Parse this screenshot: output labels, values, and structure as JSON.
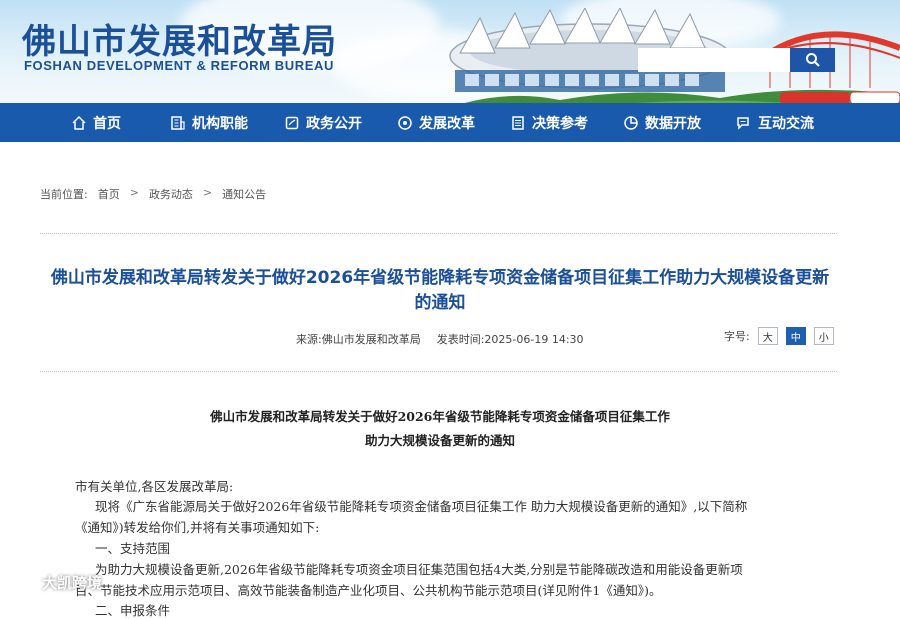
{
  "header": {
    "title": "佛山市发展和改革局",
    "subtitle": "FOSHAN DEVELOPMENT & REFORM BUREAU",
    "search_placeholder": ""
  },
  "nav": [
    {
      "label": "首页",
      "icon": "home-icon"
    },
    {
      "label": "机构职能",
      "icon": "building-icon"
    },
    {
      "label": "政务公开",
      "icon": "document-icon"
    },
    {
      "label": "发展改革",
      "icon": "compass-icon"
    },
    {
      "label": "决策参考",
      "icon": "list-icon"
    },
    {
      "label": "数据开放",
      "icon": "pie-chart-icon"
    },
    {
      "label": "互动交流",
      "icon": "chat-icon"
    }
  ],
  "breadcrumb": {
    "label": "当前位置:",
    "items": [
      "首页",
      "政务动态",
      "通知公告"
    ],
    "separator": ">"
  },
  "article": {
    "title_line1": "佛山市发展和改革局转发关于做好2026年省级节能降耗专项资金储备项目征集工作助力大规模设备更新",
    "title_line2": "的通知",
    "source": "来源:佛山市发展和改革局",
    "publish_time": "发表时间:2025-06-19 14:30",
    "font_size_label": "字号:",
    "font_sizes": [
      "大",
      "中",
      "小"
    ],
    "font_size_active": "中"
  },
  "doc": {
    "title_line1": "佛山市发展和改革局转发关于做好2026年省级节能降耗专项资金储备项目征集工作",
    "title_line2": "助力大规模设备更新的通知",
    "salutation": "市有关单位,各区发展改革局:",
    "para1_line1": "现将《广东省能源局关于做好2026年省级节能降耗专项资金储备项目征集工作 助力大规模设备更新的通知》,以下简称",
    "para1_line2": "《通知》)转发给你们,并将有关事项通知如下:",
    "section1": "一、支持范围",
    "para2_line1": "为助力大规模设备更新,2026年省级节能降耗专项资金项目征集范围包括4大类,分别是节能降碳改造和用能设备更新项",
    "para2_line2": "目、节能技术应用示范项目、高效节能装备制造产业化项目、公共机构节能示范项目(详见附件1《通知》)。",
    "para3_partial": "二、申报条件"
  },
  "watermark": {
    "text": "大凯跨境"
  },
  "colors": {
    "brand_blue": "#1b4f97",
    "nav_blue": "#1a5aad",
    "active_button": "#1f5fb0"
  }
}
